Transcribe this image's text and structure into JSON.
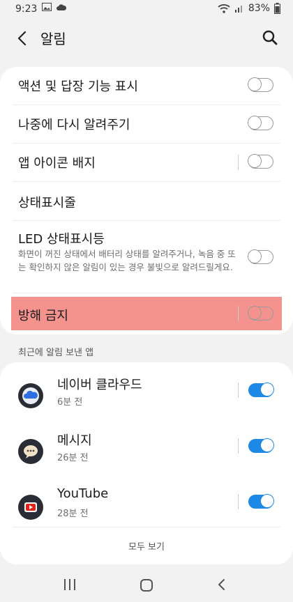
{
  "status_bar": {
    "time": "9:23",
    "battery": "83%"
  },
  "header": {
    "title": "알림"
  },
  "settings": [
    {
      "label": "액션 및 답장 기능 표시",
      "toggle": "off"
    },
    {
      "label": "나중에 다시 알려주기",
      "toggle": "off"
    },
    {
      "label": "앱 아이콘 배지",
      "toggle": "off"
    },
    {
      "label": "상태표시줄"
    },
    {
      "label": "LED 상태표시등",
      "description": "화면이 꺼진 상태에서 배터리 상태를 알려주거나, 녹음 중 또는 확인하지 않은 알림이 있는 경우 불빛으로 알려드릴게요.",
      "toggle": "off"
    },
    {
      "label": "방해 금지",
      "toggle": "off"
    }
  ],
  "recent_section": {
    "label": "최근에 알림 보낸 앱"
  },
  "recent_apps": [
    {
      "name": "네이버 클라우드",
      "time": "6분 전",
      "icon": "naver-cloud-icon",
      "toggle": "on"
    },
    {
      "name": "메시지",
      "time": "26분 전",
      "icon": "messages-icon",
      "toggle": "on"
    },
    {
      "name": "YouTube",
      "time": "28분 전",
      "icon": "youtube-icon",
      "toggle": "on"
    }
  ],
  "see_all_label": "모두 보기",
  "colors": {
    "accent": "#1e88e5",
    "highlight": "#f4938d",
    "background": "#f2f2f2"
  }
}
